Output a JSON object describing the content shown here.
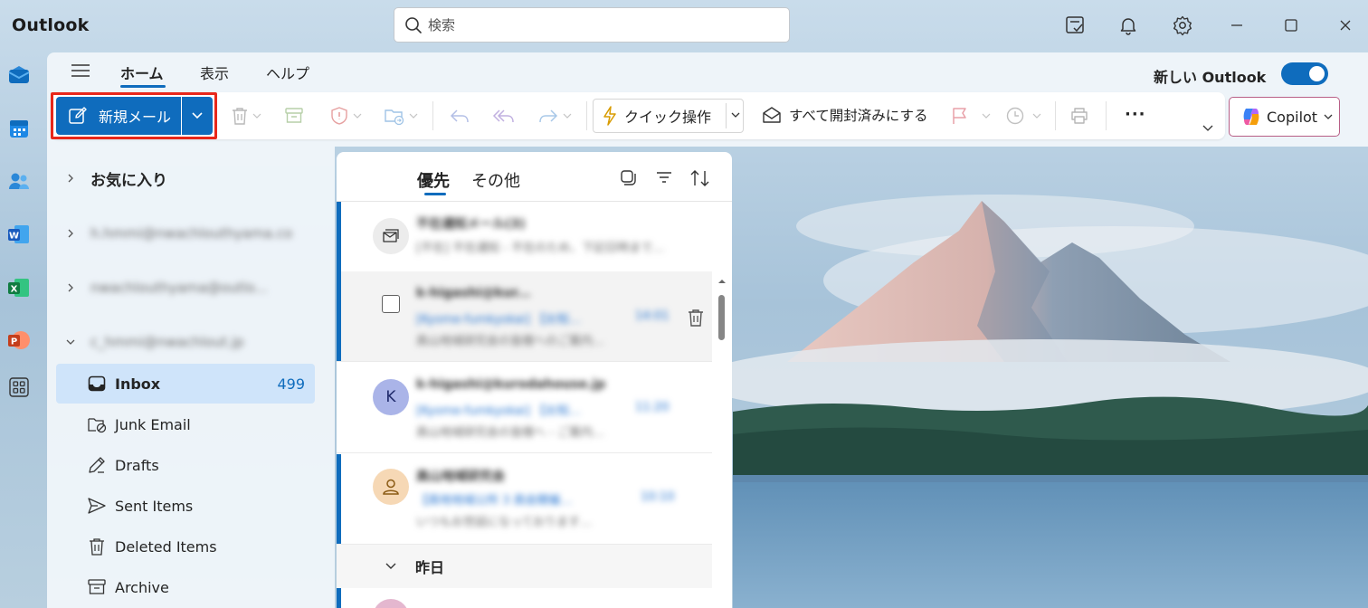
{
  "window": {
    "title": "Outlook"
  },
  "search": {
    "placeholder": "検索"
  },
  "titlebar_icons": [
    "my-day-icon",
    "bell-icon",
    "gear-icon",
    "minimize-icon",
    "maximize-icon",
    "close-icon"
  ],
  "rail": {
    "items": [
      "mail-icon",
      "calendar-icon",
      "people-icon",
      "word-icon",
      "excel-icon",
      "powerpoint-icon",
      "apps-icon"
    ]
  },
  "ribbon": {
    "tabs": [
      {
        "label": "ホーム",
        "active": true
      },
      {
        "label": "表示",
        "active": false
      },
      {
        "label": "ヘルプ",
        "active": false
      }
    ],
    "new_outlook_label": "新しい Outlook",
    "new_outlook_toggle": true,
    "new_mail_label": "新規メール",
    "quick_action_label": "クイック操作",
    "mark_all_read_label": "すべて開封済みにする",
    "more_label": "···",
    "copilot_label": "Copilot",
    "tools": [
      "delete-icon",
      "archive-icon",
      "report-icon",
      "move-icon",
      "reply-icon",
      "reply-all-icon",
      "forward-icon",
      "flag-icon",
      "snooze-icon",
      "print-icon"
    ]
  },
  "folders": {
    "favorites_label": "お気に入り",
    "accounts": [
      "h.hmmi@nwachlouthyama.co",
      "nwachlouthyama@outlo...",
      "c_hmmi@nwachlout.jp"
    ],
    "items": [
      {
        "label": "Inbox",
        "count": "499",
        "icon": "inbox-icon",
        "selected": true
      },
      {
        "label": "Junk Email",
        "count": "",
        "icon": "junk-icon",
        "selected": false
      },
      {
        "label": "Drafts",
        "count": "",
        "icon": "drafts-icon",
        "selected": false
      },
      {
        "label": "Sent Items",
        "count": "",
        "icon": "sent-icon",
        "selected": false
      },
      {
        "label": "Deleted Items",
        "count": "",
        "icon": "deleted-icon",
        "selected": false
      },
      {
        "label": "Archive",
        "count": "",
        "icon": "archive-folder-icon",
        "selected": false
      }
    ]
  },
  "message_list": {
    "tabs": [
      {
        "label": "優先",
        "active": true
      },
      {
        "label": "その他",
        "active": false
      }
    ],
    "messages": [
      {
        "avatar": "",
        "sender": "不在通知メール(3)",
        "subject": "",
        "preview": "[不在] 不在通知 - 不在のため、下記日時まで…",
        "time": ""
      },
      {
        "avatar": "",
        "sender": "k-higashi@kur...",
        "subject": "[Kyome-fumkyokai] 【お知…",
        "preview": "高山地域研究会の皆様へのご案内…",
        "time": "14:01"
      },
      {
        "avatar": "K",
        "sender": "k-higashi@kurodahouse.jp",
        "subject": "[Kyome-fumkyokai] 【お知…",
        "preview": "高山地域研究会の皆様へ - ご案内…",
        "time": "11:20"
      },
      {
        "avatar": "",
        "sender": "高山地域研究会",
        "subject": "【高地地域公所 3 高会開催…",
        "preview": "いつもお世話になっております…",
        "time": "10:10"
      }
    ],
    "day_header": "昨日"
  }
}
